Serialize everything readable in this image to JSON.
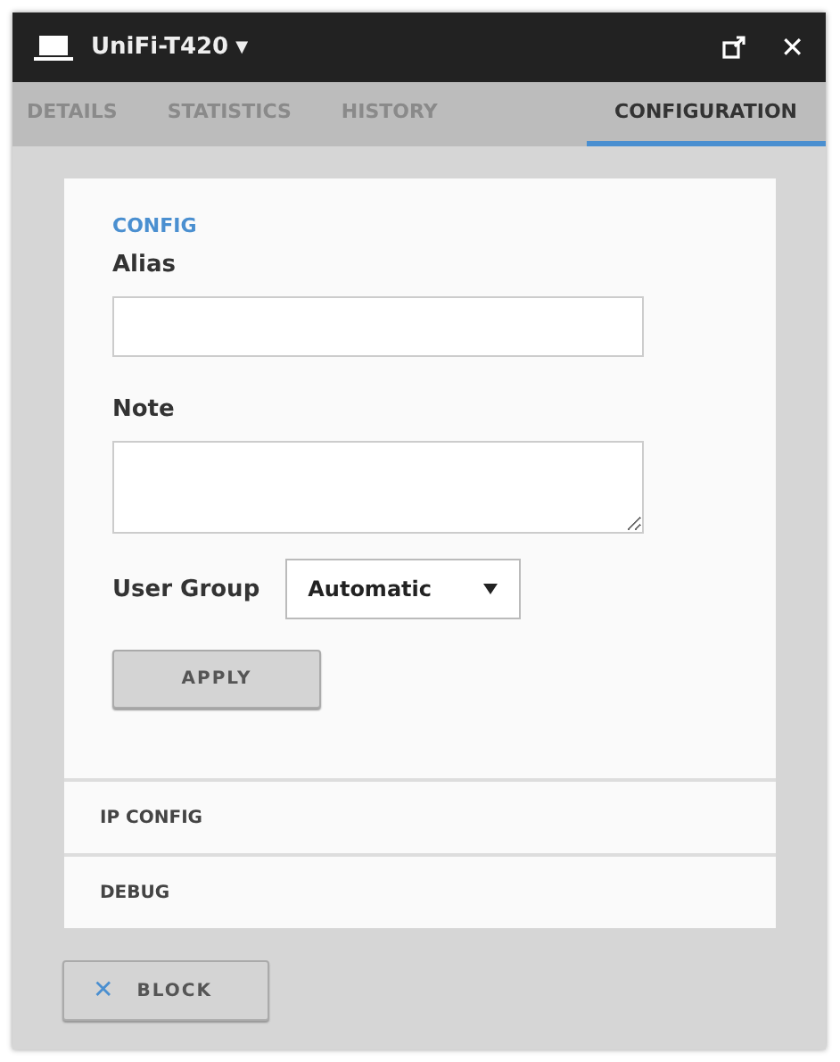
{
  "window": {
    "title": "UniFi-T420",
    "title_caret": "▼",
    "close": "✕"
  },
  "tabs": [
    {
      "label": "DETAILS",
      "selected": false
    },
    {
      "label": "STATISTICS",
      "selected": false
    },
    {
      "label": "HISTORY",
      "selected": false
    },
    {
      "label": "CONFIGURATION",
      "selected": true
    }
  ],
  "config": {
    "heading": "CONFIG",
    "alias_label": "Alias",
    "note_label": "Note",
    "user_group_label": "User Group",
    "user_group_value": "Automatic",
    "apply": "APPLY"
  },
  "sections": [
    {
      "label": "IP CONFIG",
      "expanded": false
    },
    {
      "label": "DEBUG",
      "expanded": false
    }
  ],
  "block_button": {
    "icon": "✕",
    "label": "BLOCK"
  }
}
